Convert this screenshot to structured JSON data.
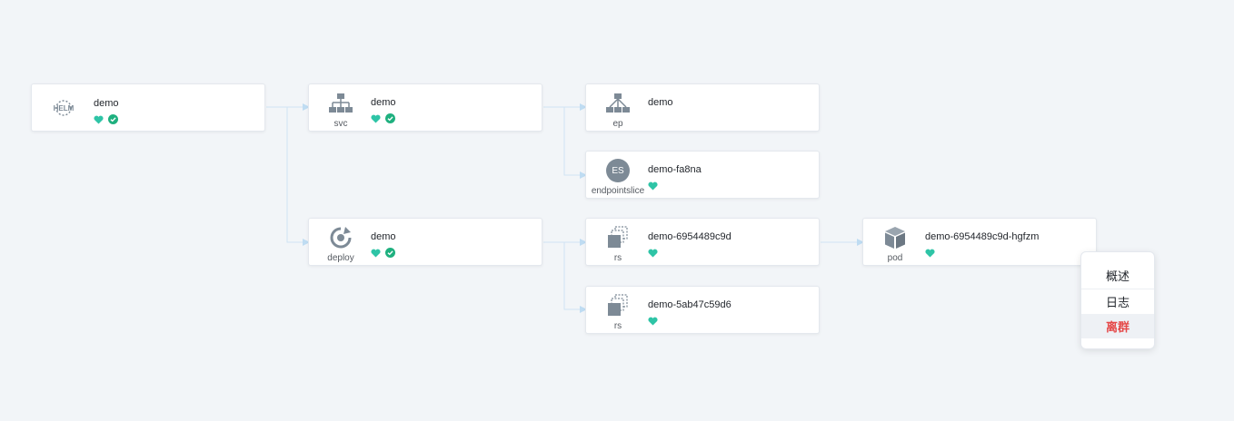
{
  "colors": {
    "background": "#f2f5f8",
    "edge": "#cfe3f3",
    "heart": "#2ec4a6",
    "check": "#1fb07f",
    "icon_gray": "#7d8a96",
    "danger": "#e54848"
  },
  "nodes": {
    "helm": {
      "icon": "helm-icon",
      "logo_text": "HELM",
      "name": "demo",
      "status": [
        "healthy",
        "synced"
      ]
    },
    "svc": {
      "icon": "service-icon",
      "kind": "svc",
      "name": "demo",
      "status": [
        "healthy",
        "synced"
      ]
    },
    "ep": {
      "icon": "endpoint-icon",
      "kind": "ep",
      "name": "demo",
      "status": []
    },
    "eps": {
      "icon": "endpointslice-icon",
      "icon_text": "ES",
      "kind": "endpointslice",
      "name": "demo-fa8na",
      "status": [
        "healthy"
      ]
    },
    "deploy": {
      "icon": "deploy-icon",
      "kind": "deploy",
      "name": "demo",
      "status": [
        "healthy",
        "synced"
      ]
    },
    "rs1": {
      "icon": "replicaset-icon",
      "kind": "rs",
      "name": "demo-6954489c9d",
      "status": [
        "healthy"
      ]
    },
    "rs2": {
      "icon": "replicaset-icon",
      "kind": "rs",
      "name": "demo-5ab47c59d6",
      "status": [
        "healthy"
      ]
    },
    "pod": {
      "icon": "pod-icon",
      "kind": "pod",
      "name": "demo-6954489c9d-hgfzm",
      "status": [
        "healthy"
      ]
    }
  },
  "context_menu": {
    "items": [
      "概述",
      "日志",
      "离群"
    ]
  }
}
